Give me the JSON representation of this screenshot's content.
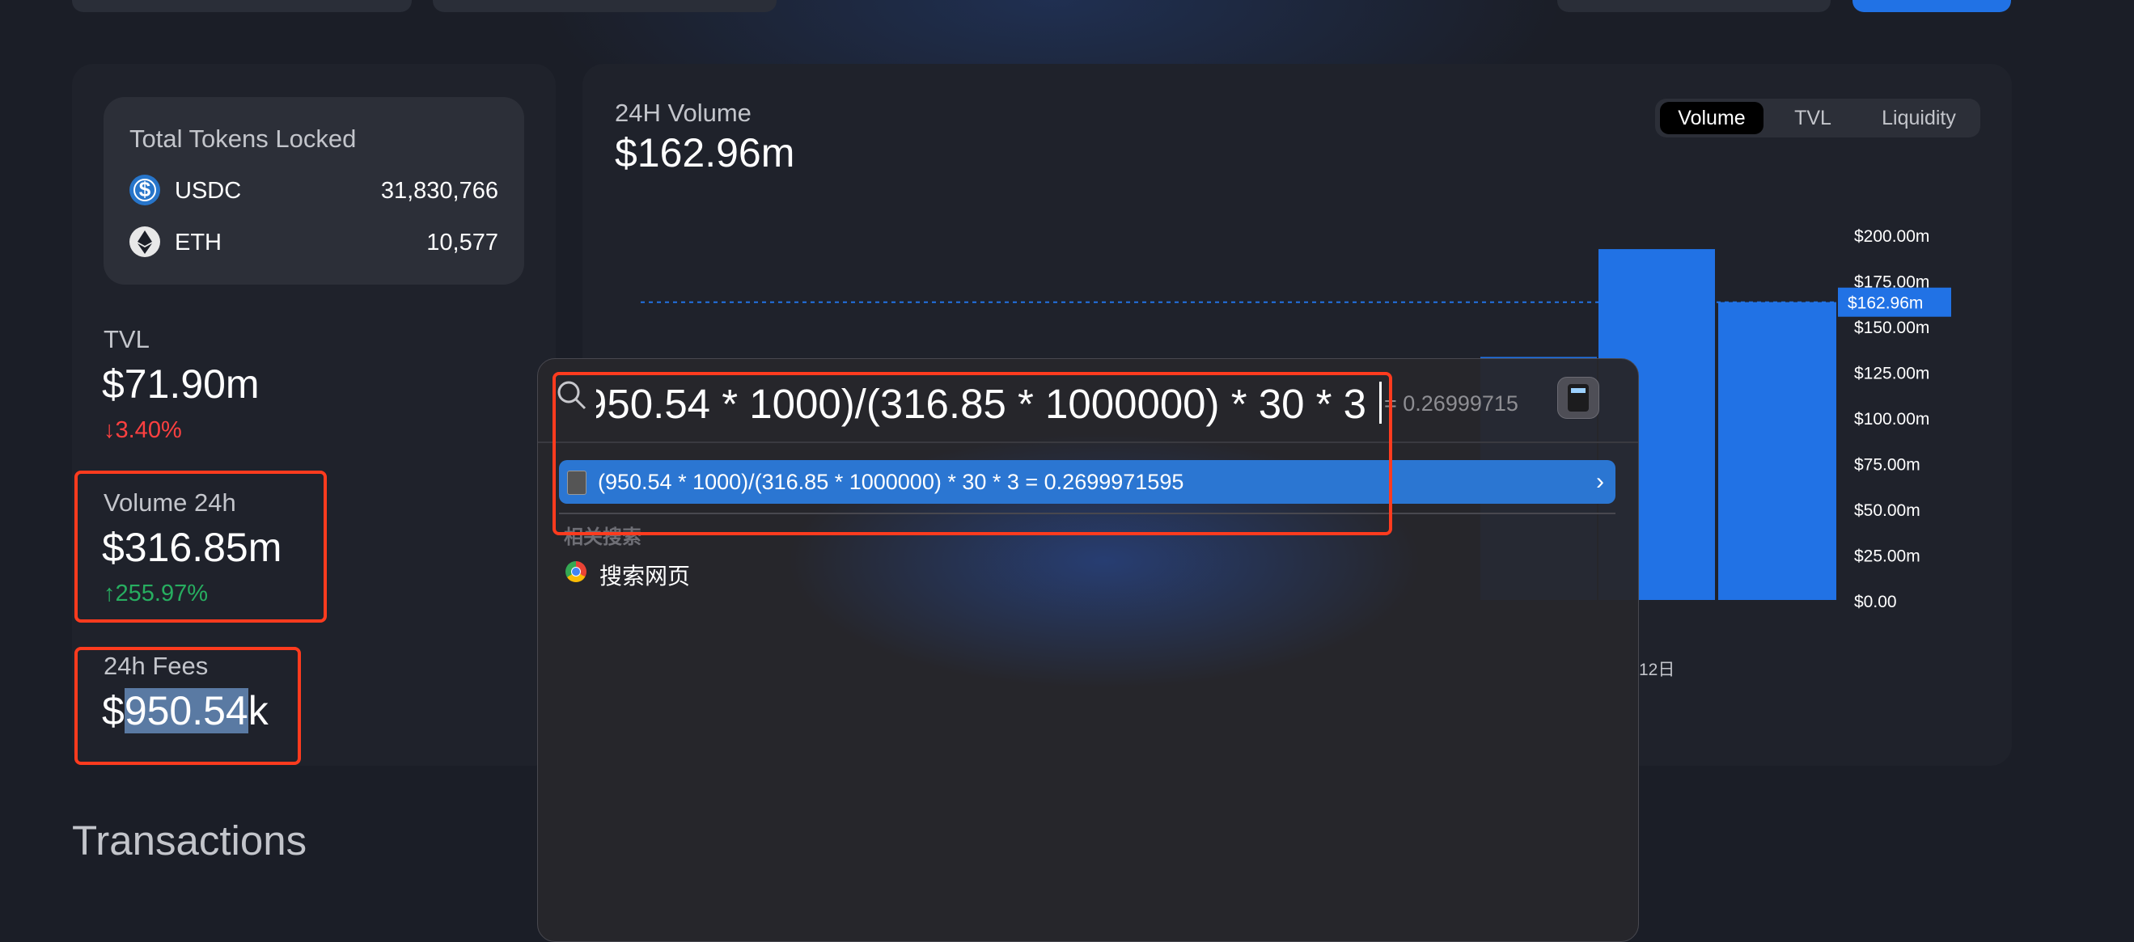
{
  "tokens": {
    "title": "Total Tokens Locked",
    "items": [
      {
        "symbol": "USDC",
        "amount": "31,830,766",
        "icon": "usdc-icon"
      },
      {
        "symbol": "ETH",
        "amount": "10,577",
        "icon": "eth-icon"
      }
    ]
  },
  "stats": {
    "tvl": {
      "label": "TVL",
      "value": "$71.90m",
      "change": "3.40%",
      "direction": "down",
      "arrow": "↓"
    },
    "volume": {
      "label": "Volume 24h",
      "value": "$316.85m",
      "change": "255.97%",
      "direction": "up",
      "arrow": "↑"
    },
    "fees": {
      "label": "24h Fees",
      "value_prefix": "$",
      "value_selected": "950.54",
      "value_suffix": "k"
    }
  },
  "chart": {
    "title": "24H Volume",
    "value": "$162.96m",
    "toggles": [
      "Volume",
      "TVL",
      "Liquidity"
    ],
    "active_toggle": "Volume",
    "highlight_label": "$162.96m",
    "x_label_visible": "12日",
    "colors": {
      "bar": "#2172e5",
      "highlight": "#2172e5"
    }
  },
  "chart_data": {
    "type": "bar",
    "title": "24H Volume",
    "ylim": [
      0,
      200
    ],
    "yticks": [
      "$200.00m",
      "$175.00m",
      "$150.00m",
      "$125.00m",
      "$100.00m",
      "$75.00m",
      "$50.00m",
      "$25.00m",
      "$0.00"
    ],
    "ytick_values": [
      200,
      175,
      150,
      125,
      100,
      75,
      50,
      25,
      0
    ],
    "categories": [
      "",
      "",
      "12日"
    ],
    "values": [
      133,
      192,
      163
    ],
    "reference_line": 162.96,
    "grid": false
  },
  "spotlight": {
    "query": "(950.54 * 1000)/(316.85 * 1000000) * 30 * 3",
    "inline_answer": "= 0.26999715",
    "result": "(950.54 * 1000)/(316.85 * 1000000) * 30 * 3 = 0.2699971595",
    "section_label": "相关搜索",
    "web_search_label": "搜索网页"
  },
  "transactions": {
    "title": "Transactions"
  }
}
